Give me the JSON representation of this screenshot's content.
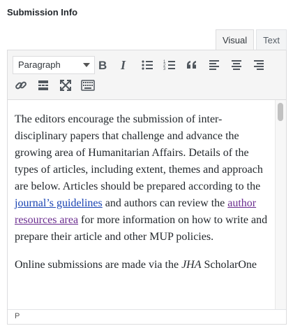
{
  "section": {
    "title": "Submission Info"
  },
  "tabs": [
    {
      "label": "Visual",
      "active": true
    },
    {
      "label": "Text",
      "active": false
    }
  ],
  "toolbar": {
    "format_select": {
      "value": "Paragraph"
    },
    "icons": [
      "bold-icon",
      "italic-icon",
      "bullet-list-icon",
      "numbered-list-icon",
      "blockquote-icon",
      "align-left-icon",
      "align-center-icon",
      "align-right-icon",
      "link-icon",
      "read-more-icon",
      "fullscreen-icon",
      "toolbar-toggle-icon"
    ]
  },
  "content": {
    "paragraph1": {
      "text_1": "The editors encourage the submission of inter-disciplinary papers that challenge and advance the growing area of Humanitarian Affairs. Details of the types of articles, including extent, themes and approach are below. Articles should be prepared according to the ",
      "link_1": "journal’s guidelines",
      "text_2": " and authors can review the ",
      "link_2": "author resources area",
      "text_3": " for more information on how to write and prepare their article and other MUP policies."
    },
    "paragraph2": {
      "text_1": "Online submissions are made via the ",
      "italic": "JHA",
      "text_2": " ScholarOne"
    }
  },
  "statusbar": {
    "path": "P"
  },
  "colors": {
    "link": "#1a44b3",
    "visited_link": "#6b2d8f",
    "toolbar_bg": "#f5f5f5"
  }
}
